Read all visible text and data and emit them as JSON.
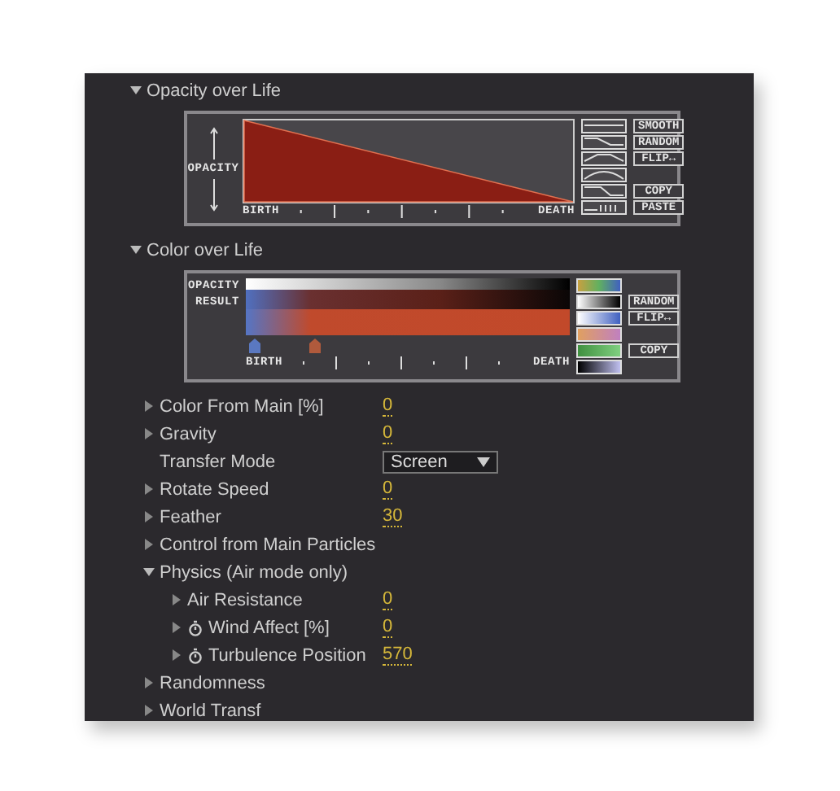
{
  "opacity_over_life": {
    "title": "Opacity over Life",
    "expanded": true,
    "y_label": "OPACITY",
    "x_start": "BIRTH",
    "x_end": "DEATH",
    "buttons": [
      {
        "label": "SMOOTH",
        "gap_before": false
      },
      {
        "label": "RANDOM",
        "gap_before": false
      },
      {
        "label": "FLIP↔",
        "gap_before": false
      },
      {
        "label": "COPY",
        "gap_before": true
      },
      {
        "label": "PASTE",
        "gap_before": false
      }
    ]
  },
  "color_over_life": {
    "title": "Color over Life",
    "expanded": true,
    "row_labels": [
      "OPACITY",
      "RESULT"
    ],
    "x_start": "BIRTH",
    "x_end": "DEATH",
    "markers": [
      {
        "color": "#5a78c0"
      },
      {
        "color": "#b05a3c"
      }
    ],
    "buttons": [
      {
        "label": "RANDOM",
        "gap_before": true
      },
      {
        "label": "FLIP↔",
        "gap_before": false
      },
      {
        "label": "COPY",
        "gap_before": true
      }
    ]
  },
  "properties": [
    {
      "kind": "value",
      "label": "Color From Main [%]",
      "value": "0",
      "expanded": false,
      "stopwatch": false
    },
    {
      "kind": "value",
      "label": "Gravity",
      "value": "0",
      "expanded": false,
      "stopwatch": false
    },
    {
      "kind": "dropdown",
      "label": "Transfer Mode",
      "value": "Screen"
    },
    {
      "kind": "value",
      "label": "Rotate Speed",
      "value": "0",
      "expanded": false,
      "stopwatch": false
    },
    {
      "kind": "value",
      "label": "Feather",
      "value": "30",
      "expanded": false,
      "stopwatch": false
    },
    {
      "kind": "group",
      "label": "Control from Main Particles",
      "expanded": false
    },
    {
      "kind": "group",
      "label": "Physics (Air mode only)",
      "expanded": true,
      "children": [
        {
          "kind": "value",
          "label": "Air Resistance",
          "value": "0",
          "expanded": false,
          "stopwatch": false
        },
        {
          "kind": "value",
          "label": "Wind Affect [%]",
          "value": "0",
          "expanded": false,
          "stopwatch": true
        },
        {
          "kind": "value",
          "label": "Turbulence Position",
          "value": "570",
          "expanded": false,
          "stopwatch": true
        }
      ]
    },
    {
      "kind": "group",
      "label": "Randomness",
      "expanded": false
    },
    {
      "kind": "group",
      "label": "World Transf",
      "expanded": false
    }
  ]
}
